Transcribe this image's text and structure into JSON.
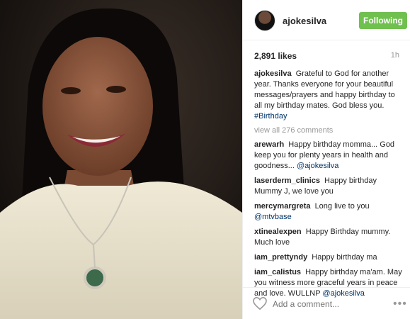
{
  "post": {
    "username": "ajokesilva",
    "follow_label": "Following",
    "likes": "2,891 likes",
    "time": "1h",
    "caption_user": "ajokesilva",
    "caption_text": "Grateful to God for another year. Thanks everyone for your beautiful messages/prayers and happy birthday to all my birthday mates. God bless you.",
    "caption_tag": "#Birthday",
    "view_all": "view all 276 comments"
  },
  "comments": [
    {
      "user": "arewarh",
      "text": "Happy birthday momma... God keep you for plenty years in health and goodness...",
      "mention": "@ajokesilva"
    },
    {
      "user": "laserderm_clinics",
      "text": "Happy birthday Mummy J, we love you",
      "mention": ""
    },
    {
      "user": "mercymargreta",
      "text": "Long live to you",
      "mention": "@mtvbase"
    },
    {
      "user": "xtinealexpen",
      "text": "Happy Birthday mummy. Much love",
      "mention": ""
    },
    {
      "user": "iam_prettyndy",
      "text": "Happy birthday ma",
      "mention": ""
    },
    {
      "user": "iam_calistus",
      "text": "Happy birthday ma'am. May you witness more graceful years in peace and love. WULLNP",
      "mention": "@ajokesilva"
    }
  ],
  "footer": {
    "add_comment_placeholder": "Add a comment...",
    "more_label": "•••"
  },
  "icons": {
    "like": "heart-icon",
    "more": "more-options-icon"
  },
  "colors": {
    "follow_green": "#70c050",
    "link_blue": "#003569",
    "muted": "#999999"
  }
}
